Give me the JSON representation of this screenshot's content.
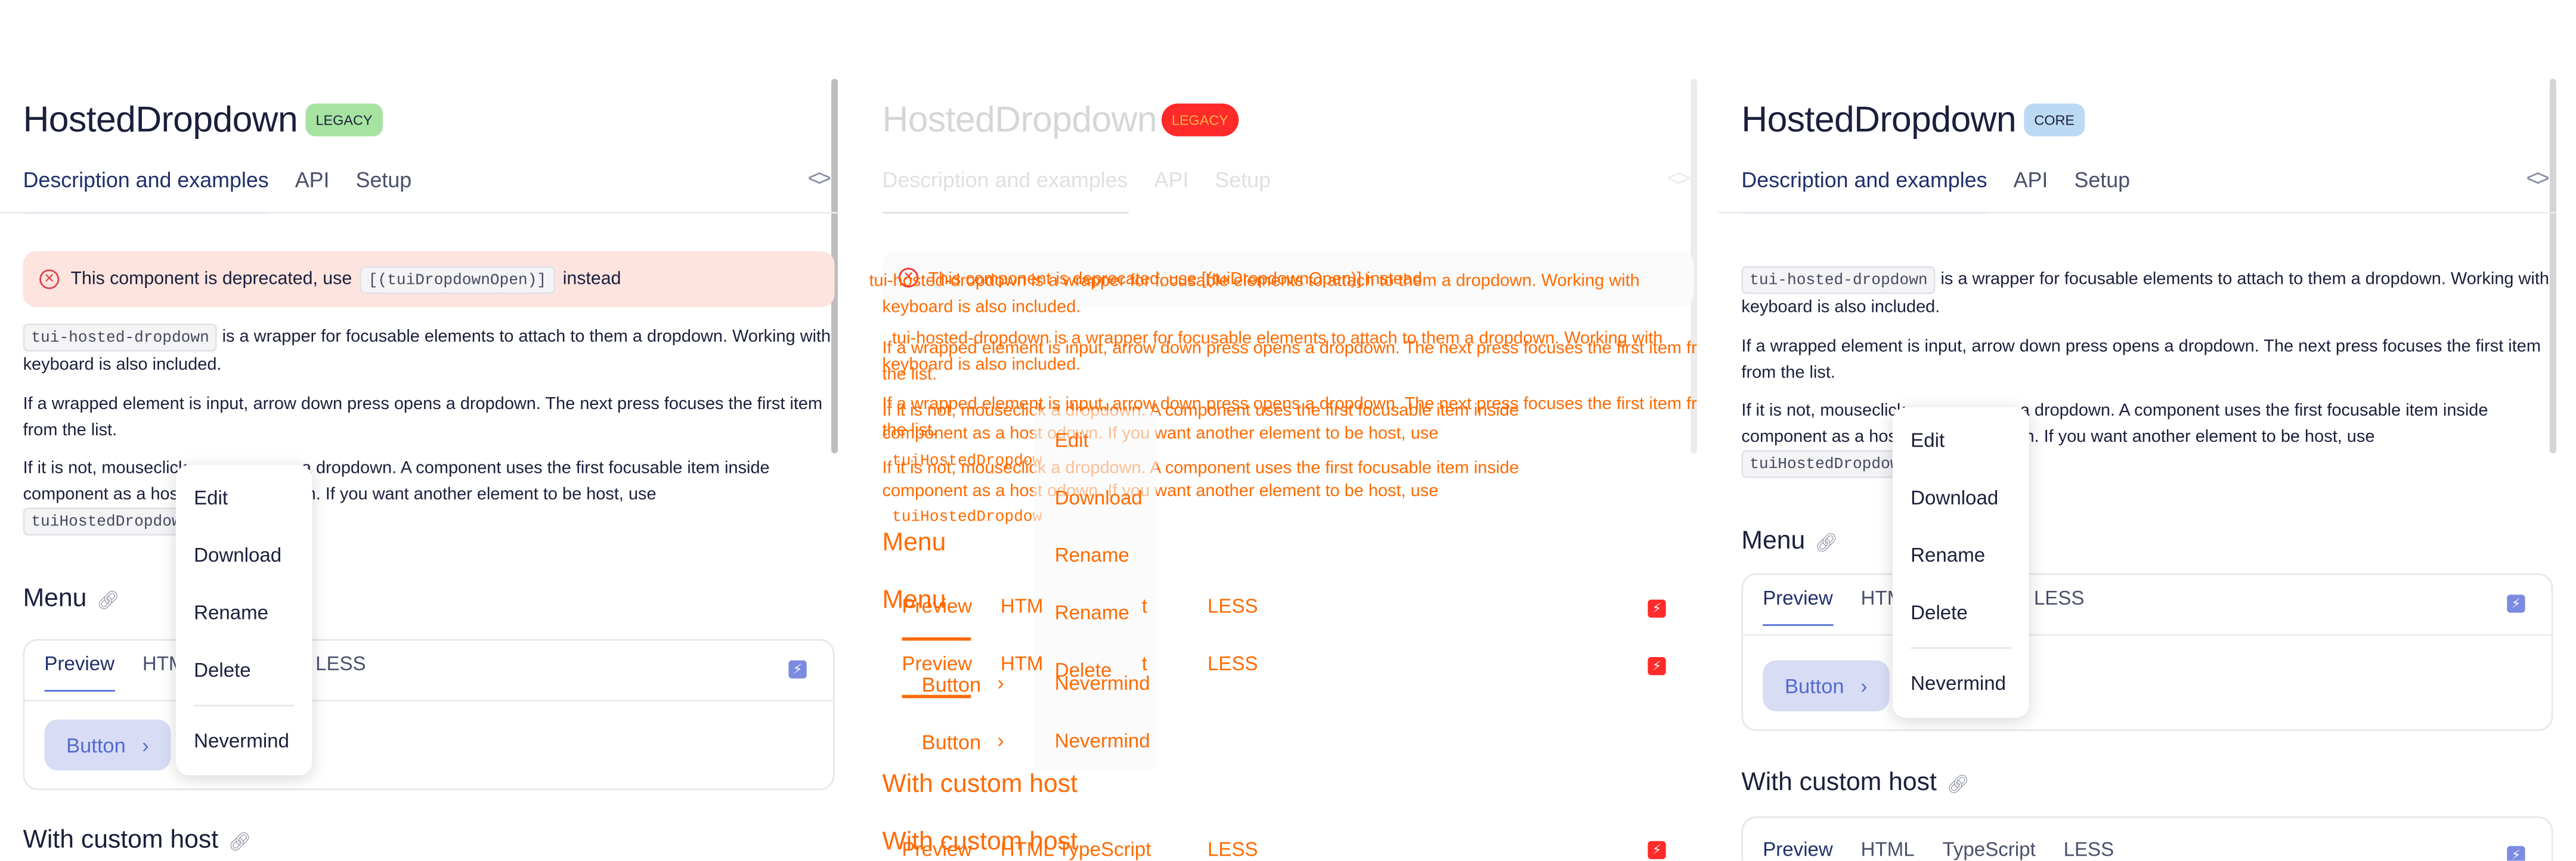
{
  "component_title": "HostedDropdown",
  "badges": {
    "legacy": "LEGACY",
    "core": "CORE"
  },
  "tabs": [
    "Description and examples",
    "API",
    "Setup"
  ],
  "code_toggle": "<>",
  "notice": {
    "before": "This component is deprecated, use",
    "code": "[(tuiDropdownOpen)]",
    "after": "instead"
  },
  "description": {
    "code_host": "tui-hosted-dropdown",
    "p1": "is a wrapper for focusable elements to attach to them a dropdown. Working with keyboard is also included.",
    "p2": "If a wrapped element is input, arrow down press opens a dropdown. The next press focuses the first item from the list.",
    "p3_left": "If it is not, mouseclick",
    "p3_mid": "a dropdown. A component uses the first focusable item inside",
    "p3_line2_left": "component as a host",
    "p3_line2_right": "odown. If you want another element to be host, use",
    "code_directive": "tuiHostedDropdow"
  },
  "sections": {
    "menu": "Menu",
    "custom_host": "With custom host"
  },
  "demo_tabs": [
    "Preview",
    "HTML",
    "TypeScript",
    "LESS"
  ],
  "demo_tabs_partial": {
    "preview": "Preview",
    "html": "HTM",
    "ts": "t",
    "less": "LESS"
  },
  "button_label": "Button",
  "dropdown_items": [
    "Edit",
    "Download",
    "Rename",
    "Delete",
    "Nevermind"
  ],
  "ghost": {
    "notice_overlap": "This component is deprecated, use [(tuiDropdownOpen)] instead",
    "line_a": "tui-hosted-dropdown is a wrapper for focusable elements to attach to them a dropdown. Working with",
    "line_b": "keyboard is also included.",
    "line_c": "If a wrapped element is input, arrow down press opens a dropdown. The next press focuses the first item from",
    "line_d": "the list.",
    "line_e": "If it is not, mouseclick       a dropdown. A component uses the first focusable item inside",
    "line_f": "component as a host       odown. If you want another element to be host, use",
    "line_g": "tuiHostedDropdow",
    "menu_edit": "Edit",
    "menu_download": "Download",
    "menu_rename": "Rename",
    "menu_delete": "Delete",
    "menu_nevermind": "Nevermind",
    "button": "Button",
    "preview": "Preview",
    "html": "HTM",
    "ts_frag": "t",
    "less": "LESS",
    "section_menu": "Menu",
    "section_custom": "With custom host",
    "ts_full": "TypeScript",
    "html_full": "HTML"
  },
  "colors": {
    "accent": "#526ed3",
    "legacy_badge": "#a6e3a1",
    "core_badge": "#bcd9f4",
    "error": "#e0414c",
    "diff_overlay": "#ff6a00"
  }
}
